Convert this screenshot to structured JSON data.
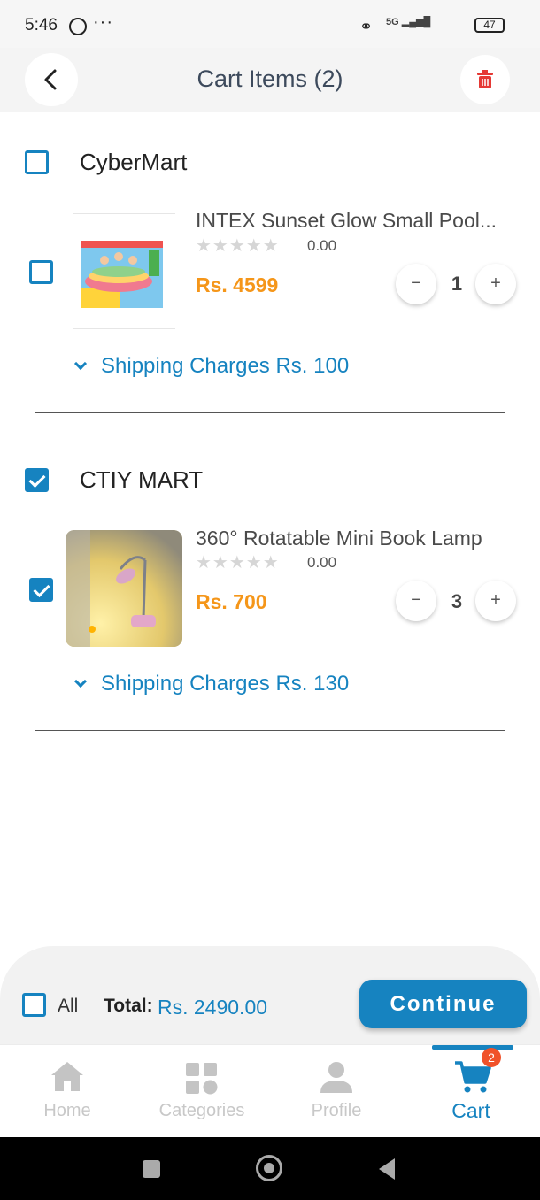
{
  "status_bar": {
    "time": "5:46",
    "battery": "47",
    "network": "5G"
  },
  "header": {
    "title": "Cart Items (2)"
  },
  "vendors": [
    {
      "name": "CyberMart",
      "selected": false,
      "item": {
        "name": "INTEX Sunset Glow Small Pool...",
        "rating": "0.00",
        "price": "Rs. 4599",
        "quantity": "1",
        "selected": false
      },
      "shipping": "Shipping Charges Rs.  100"
    },
    {
      "name": "CTIY MART",
      "selected": true,
      "item": {
        "name": "360° Rotatable Mini Book Lamp",
        "rating": "0.00",
        "price": "Rs. 700",
        "quantity": "3",
        "selected": true
      },
      "shipping": "Shipping Charges Rs.  130"
    }
  ],
  "footer": {
    "all_label": "All",
    "total_label": "Total:",
    "total_value": "Rs.  2490.00",
    "continue_label": "Continue"
  },
  "nav": {
    "items": [
      {
        "label": "Home",
        "icon": "home-icon"
      },
      {
        "label": "Categories",
        "icon": "grid-icon"
      },
      {
        "label": "Profile",
        "icon": "person-icon"
      },
      {
        "label": "Cart",
        "icon": "cart-icon"
      }
    ],
    "active": "Cart",
    "cart_badge": "2"
  },
  "colors": {
    "accent": "#1683c0",
    "price": "#f59619",
    "badge": "#f0522a"
  }
}
